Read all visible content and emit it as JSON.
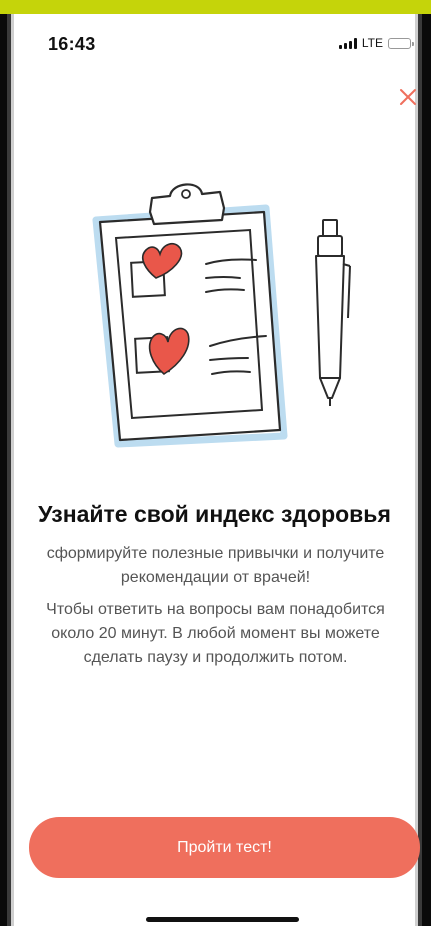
{
  "status_bar": {
    "time": "16:43",
    "network": "LTE",
    "signal_bars_active": 3,
    "battery_level": "low"
  },
  "screen": {
    "close_icon": "close-icon",
    "illustration": "clipboard-with-hearts-and-pen-illustration",
    "title": "Узнайте свой индекс здоровья",
    "subtitle": "сформируйте полезные привычки и получите рекомендации от врачей!",
    "description": "Чтобы ответить на вопросы вам понадобится около 20 минут. В любой момент вы можете сделать паузу и продолжить потом.",
    "cta_label": "Пройти тест!"
  },
  "colors": {
    "accent": "#ef6f5d",
    "heart": "#e9574a",
    "clipboard_outline": "#2b2b2b",
    "clipboard_shadow": "#bcdcf0",
    "top_frame": "#c5d40a",
    "body_text": "#555555"
  }
}
